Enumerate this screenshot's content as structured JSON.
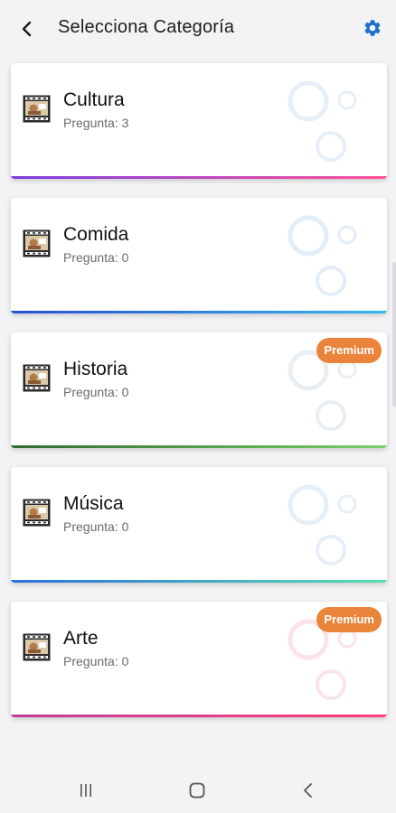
{
  "header": {
    "title": "Selecciona Categoría",
    "back_icon": "arrow-back-icon",
    "settings_icon": "gear-icon",
    "accent": "#1f6fc5"
  },
  "categories": [
    {
      "name": "Cultura",
      "count_text": "Pregunta: 3",
      "premium": false,
      "bar_gradient": [
        "#7b3fe0",
        "#ff4f9a"
      ],
      "circle_color": "#e6eef7"
    },
    {
      "name": "Comida",
      "count_text": "Pregunta: 0",
      "premium": false,
      "bar_gradient": [
        "#2a4fd6",
        "#35b6f0"
      ],
      "circle_color": "#e3edf8"
    },
    {
      "name": "Historia",
      "count_text": "Pregunta: 0",
      "premium": true,
      "bar_gradient": [
        "#2e6b2c",
        "#7bcf6a"
      ],
      "circle_color": "#e8eef3"
    },
    {
      "name": "Música",
      "count_text": "Pregunta: 0",
      "premium": false,
      "bar_gradient": [
        "#2a6fe0",
        "#56e0b0"
      ],
      "circle_color": "#e6eef7"
    },
    {
      "name": "Arte",
      "count_text": "Pregunta: 0",
      "premium": true,
      "bar_gradient": [
        "#c23a9a",
        "#ff3f7a"
      ],
      "circle_color": "#fbe3ea"
    }
  ],
  "premium_label": "Premium",
  "premium_color": "#e9843a",
  "navigation": {
    "recents_icon": "recents-icon",
    "home_icon": "home-icon",
    "back_icon": "back-chevron-icon"
  }
}
